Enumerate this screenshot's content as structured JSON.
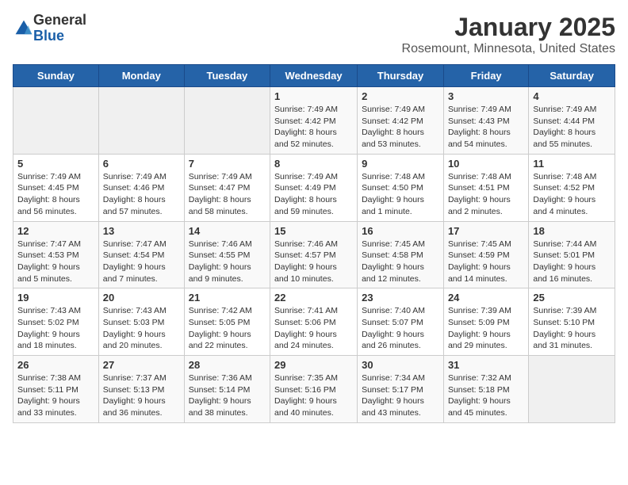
{
  "logo": {
    "general": "General",
    "blue": "Blue"
  },
  "header": {
    "title": "January 2025",
    "subtitle": "Rosemount, Minnesota, United States"
  },
  "weekdays": [
    "Sunday",
    "Monday",
    "Tuesday",
    "Wednesday",
    "Thursday",
    "Friday",
    "Saturday"
  ],
  "weeks": [
    [
      {
        "day": "",
        "info": ""
      },
      {
        "day": "",
        "info": ""
      },
      {
        "day": "",
        "info": ""
      },
      {
        "day": "1",
        "info": "Sunrise: 7:49 AM\nSunset: 4:42 PM\nDaylight: 8 hours\nand 52 minutes."
      },
      {
        "day": "2",
        "info": "Sunrise: 7:49 AM\nSunset: 4:42 PM\nDaylight: 8 hours\nand 53 minutes."
      },
      {
        "day": "3",
        "info": "Sunrise: 7:49 AM\nSunset: 4:43 PM\nDaylight: 8 hours\nand 54 minutes."
      },
      {
        "day": "4",
        "info": "Sunrise: 7:49 AM\nSunset: 4:44 PM\nDaylight: 8 hours\nand 55 minutes."
      }
    ],
    [
      {
        "day": "5",
        "info": "Sunrise: 7:49 AM\nSunset: 4:45 PM\nDaylight: 8 hours\nand 56 minutes."
      },
      {
        "day": "6",
        "info": "Sunrise: 7:49 AM\nSunset: 4:46 PM\nDaylight: 8 hours\nand 57 minutes."
      },
      {
        "day": "7",
        "info": "Sunrise: 7:49 AM\nSunset: 4:47 PM\nDaylight: 8 hours\nand 58 minutes."
      },
      {
        "day": "8",
        "info": "Sunrise: 7:49 AM\nSunset: 4:49 PM\nDaylight: 8 hours\nand 59 minutes."
      },
      {
        "day": "9",
        "info": "Sunrise: 7:48 AM\nSunset: 4:50 PM\nDaylight: 9 hours\nand 1 minute."
      },
      {
        "day": "10",
        "info": "Sunrise: 7:48 AM\nSunset: 4:51 PM\nDaylight: 9 hours\nand 2 minutes."
      },
      {
        "day": "11",
        "info": "Sunrise: 7:48 AM\nSunset: 4:52 PM\nDaylight: 9 hours\nand 4 minutes."
      }
    ],
    [
      {
        "day": "12",
        "info": "Sunrise: 7:47 AM\nSunset: 4:53 PM\nDaylight: 9 hours\nand 5 minutes."
      },
      {
        "day": "13",
        "info": "Sunrise: 7:47 AM\nSunset: 4:54 PM\nDaylight: 9 hours\nand 7 minutes."
      },
      {
        "day": "14",
        "info": "Sunrise: 7:46 AM\nSunset: 4:55 PM\nDaylight: 9 hours\nand 9 minutes."
      },
      {
        "day": "15",
        "info": "Sunrise: 7:46 AM\nSunset: 4:57 PM\nDaylight: 9 hours\nand 10 minutes."
      },
      {
        "day": "16",
        "info": "Sunrise: 7:45 AM\nSunset: 4:58 PM\nDaylight: 9 hours\nand 12 minutes."
      },
      {
        "day": "17",
        "info": "Sunrise: 7:45 AM\nSunset: 4:59 PM\nDaylight: 9 hours\nand 14 minutes."
      },
      {
        "day": "18",
        "info": "Sunrise: 7:44 AM\nSunset: 5:01 PM\nDaylight: 9 hours\nand 16 minutes."
      }
    ],
    [
      {
        "day": "19",
        "info": "Sunrise: 7:43 AM\nSunset: 5:02 PM\nDaylight: 9 hours\nand 18 minutes."
      },
      {
        "day": "20",
        "info": "Sunrise: 7:43 AM\nSunset: 5:03 PM\nDaylight: 9 hours\nand 20 minutes."
      },
      {
        "day": "21",
        "info": "Sunrise: 7:42 AM\nSunset: 5:05 PM\nDaylight: 9 hours\nand 22 minutes."
      },
      {
        "day": "22",
        "info": "Sunrise: 7:41 AM\nSunset: 5:06 PM\nDaylight: 9 hours\nand 24 minutes."
      },
      {
        "day": "23",
        "info": "Sunrise: 7:40 AM\nSunset: 5:07 PM\nDaylight: 9 hours\nand 26 minutes."
      },
      {
        "day": "24",
        "info": "Sunrise: 7:39 AM\nSunset: 5:09 PM\nDaylight: 9 hours\nand 29 minutes."
      },
      {
        "day": "25",
        "info": "Sunrise: 7:39 AM\nSunset: 5:10 PM\nDaylight: 9 hours\nand 31 minutes."
      }
    ],
    [
      {
        "day": "26",
        "info": "Sunrise: 7:38 AM\nSunset: 5:11 PM\nDaylight: 9 hours\nand 33 minutes."
      },
      {
        "day": "27",
        "info": "Sunrise: 7:37 AM\nSunset: 5:13 PM\nDaylight: 9 hours\nand 36 minutes."
      },
      {
        "day": "28",
        "info": "Sunrise: 7:36 AM\nSunset: 5:14 PM\nDaylight: 9 hours\nand 38 minutes."
      },
      {
        "day": "29",
        "info": "Sunrise: 7:35 AM\nSunset: 5:16 PM\nDaylight: 9 hours\nand 40 minutes."
      },
      {
        "day": "30",
        "info": "Sunrise: 7:34 AM\nSunset: 5:17 PM\nDaylight: 9 hours\nand 43 minutes."
      },
      {
        "day": "31",
        "info": "Sunrise: 7:32 AM\nSunset: 5:18 PM\nDaylight: 9 hours\nand 45 minutes."
      },
      {
        "day": "",
        "info": ""
      }
    ]
  ]
}
